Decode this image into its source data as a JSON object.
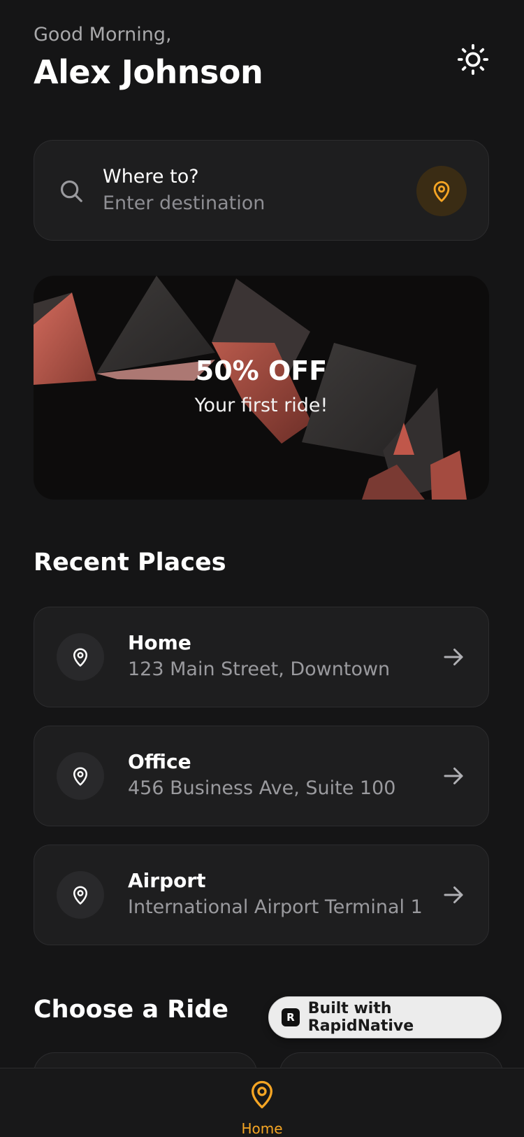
{
  "header": {
    "greeting": "Good Morning,",
    "user_name": "Alex Johnson",
    "theme_icon": "sun-icon"
  },
  "search": {
    "title": "Where to?",
    "placeholder": "Enter destination",
    "search_icon": "search-icon",
    "locate_icon": "map-pin-icon"
  },
  "promo": {
    "title": "50% OFF",
    "subtitle": "Your first ride!"
  },
  "recent_places": {
    "title": "Recent Places",
    "items": [
      {
        "name": "Home",
        "address": "123 Main Street, Downtown"
      },
      {
        "name": "Office",
        "address": "456 Business Ave, Suite 100"
      },
      {
        "name": "Airport",
        "address": "International Airport Terminal 1"
      }
    ]
  },
  "rides": {
    "title": "Choose a Ride"
  },
  "badge": {
    "logo": "R",
    "text": "Built with RapidNative"
  },
  "tab_bar": {
    "home_label": "Home"
  },
  "colors": {
    "accent": "#f5a524",
    "background": "#151516",
    "card": "#1e1e1f"
  }
}
